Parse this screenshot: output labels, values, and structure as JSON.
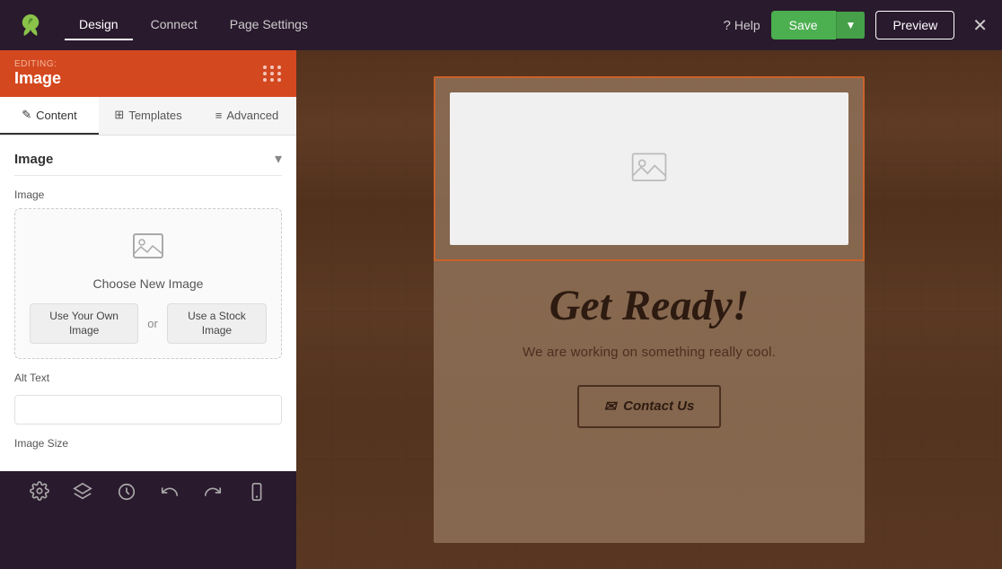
{
  "nav": {
    "tabs": [
      {
        "id": "design",
        "label": "Design",
        "active": true
      },
      {
        "id": "connect",
        "label": "Connect",
        "active": false
      },
      {
        "id": "page-settings",
        "label": "Page Settings",
        "active": false
      }
    ],
    "help_label": "Help",
    "save_label": "Save",
    "preview_label": "Preview"
  },
  "editing_panel": {
    "editing_label": "EDITING:",
    "editing_title": "Image",
    "tabs": [
      {
        "id": "content",
        "label": "Content",
        "icon": "pencil-icon",
        "active": true
      },
      {
        "id": "templates",
        "label": "Templates",
        "icon": "templates-icon",
        "active": false
      },
      {
        "id": "advanced",
        "label": "Advanced",
        "icon": "advanced-icon",
        "active": false
      }
    ],
    "section_title": "Image",
    "image_label": "Image",
    "choose_text": "Choose New Image",
    "use_own_label": "Use Your Own Image",
    "or_label": "or",
    "stock_label": "Use a Stock Image",
    "alt_text_label": "Alt Text",
    "alt_text_placeholder": "",
    "image_size_label": "Image Size"
  },
  "bottom_toolbar": {
    "icons": [
      {
        "id": "settings-icon",
        "symbol": "⚙"
      },
      {
        "id": "layers-icon",
        "symbol": "◈"
      },
      {
        "id": "history-icon",
        "symbol": "⟳"
      },
      {
        "id": "undo-icon",
        "symbol": "↺"
      },
      {
        "id": "redo-icon",
        "symbol": "↻"
      },
      {
        "id": "mobile-icon",
        "symbol": "📱"
      }
    ]
  },
  "canvas": {
    "get_ready_text": "Get Ready!",
    "working_text": "We are working on something really cool.",
    "contact_btn_label": "Contact Us"
  }
}
